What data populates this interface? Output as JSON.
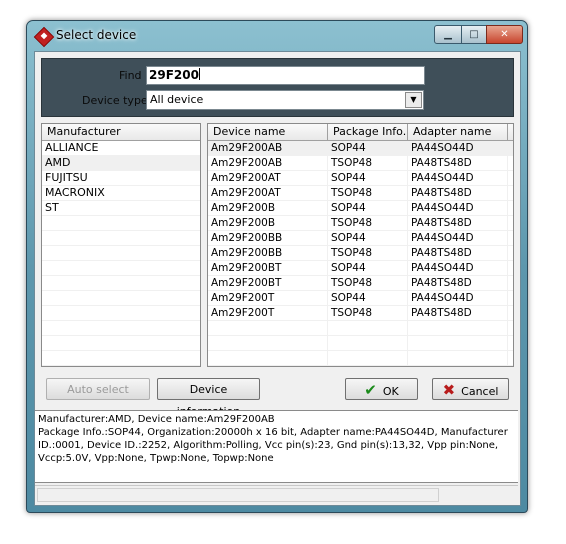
{
  "window": {
    "title": "Select device"
  },
  "find": {
    "label": "Find",
    "value": "29F200"
  },
  "device_type": {
    "label": "Device type",
    "selected": "All device"
  },
  "manufacturers": {
    "header": "Manufacturer",
    "items": [
      "ALLIANCE",
      "AMD",
      "FUJITSU",
      "MACRONIX",
      "ST"
    ],
    "selected": "AMD"
  },
  "devices": {
    "columns": [
      "Device name",
      "Package Info.",
      "Adapter name"
    ],
    "rows": [
      [
        "Am29F200AB",
        "SOP44",
        "PA44SO44D"
      ],
      [
        "Am29F200AB",
        "TSOP48",
        "PA48TS48D"
      ],
      [
        "Am29F200AT",
        "SOP44",
        "PA44SO44D"
      ],
      [
        "Am29F200AT",
        "TSOP48",
        "PA48TS48D"
      ],
      [
        "Am29F200B",
        "SOP44",
        "PA44SO44D"
      ],
      [
        "Am29F200B",
        "TSOP48",
        "PA48TS48D"
      ],
      [
        "Am29F200BB",
        "SOP44",
        "PA44SO44D"
      ],
      [
        "Am29F200BB",
        "TSOP48",
        "PA48TS48D"
      ],
      [
        "Am29F200BT",
        "SOP44",
        "PA44SO44D"
      ],
      [
        "Am29F200BT",
        "TSOP48",
        "PA48TS48D"
      ],
      [
        "Am29F200T",
        "SOP44",
        "PA44SO44D"
      ],
      [
        "Am29F200T",
        "TSOP48",
        "PA48TS48D"
      ]
    ]
  },
  "buttons": {
    "auto_select": "Auto select",
    "device_information": "Device information",
    "ok": "OK",
    "cancel": "Cancel"
  },
  "info": {
    "lines": [
      "Manufacturer:AMD, Device name:Am29F200AB",
      "Package Info.:SOP44, Organization:20000h x 16 bit, Adapter name:PA44SO44D, Manufacturer",
      "ID.:0001, Device ID.:2252, Algorithm:Polling, Vcc pin(s):23, Gnd pin(s):13,32, Vpp pin:None,",
      "Vccp:5.0V, Vpp:None, Tpwp:None, Topwp:None"
    ]
  }
}
